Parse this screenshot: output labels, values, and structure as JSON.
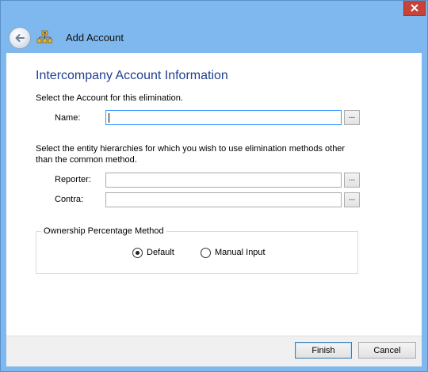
{
  "window": {
    "title": "Add Account"
  },
  "page": {
    "heading": "Intercompany Account Information",
    "account_instruction": "Select the Account for this elimination.",
    "name_label": "Name:",
    "name_value": "",
    "hierarchy_instruction_line1": "Select the entity hierarchies for which you wish to use elimination methods other",
    "hierarchy_instruction_line2": "than the common method.",
    "reporter_label": "Reporter:",
    "reporter_value": "",
    "contra_label": "Contra:",
    "contra_value": "",
    "browse_label": "...",
    "ownership_group_label": "Ownership Percentage Method",
    "options": [
      {
        "label": "Default",
        "selected": true
      },
      {
        "label": "Manual Input",
        "selected": false
      }
    ]
  },
  "footer": {
    "finish_label": "Finish",
    "cancel_label": "Cancel"
  },
  "colors": {
    "accent": "#7fb8ee",
    "heading": "#1f3f8f",
    "close": "#c7433a"
  }
}
